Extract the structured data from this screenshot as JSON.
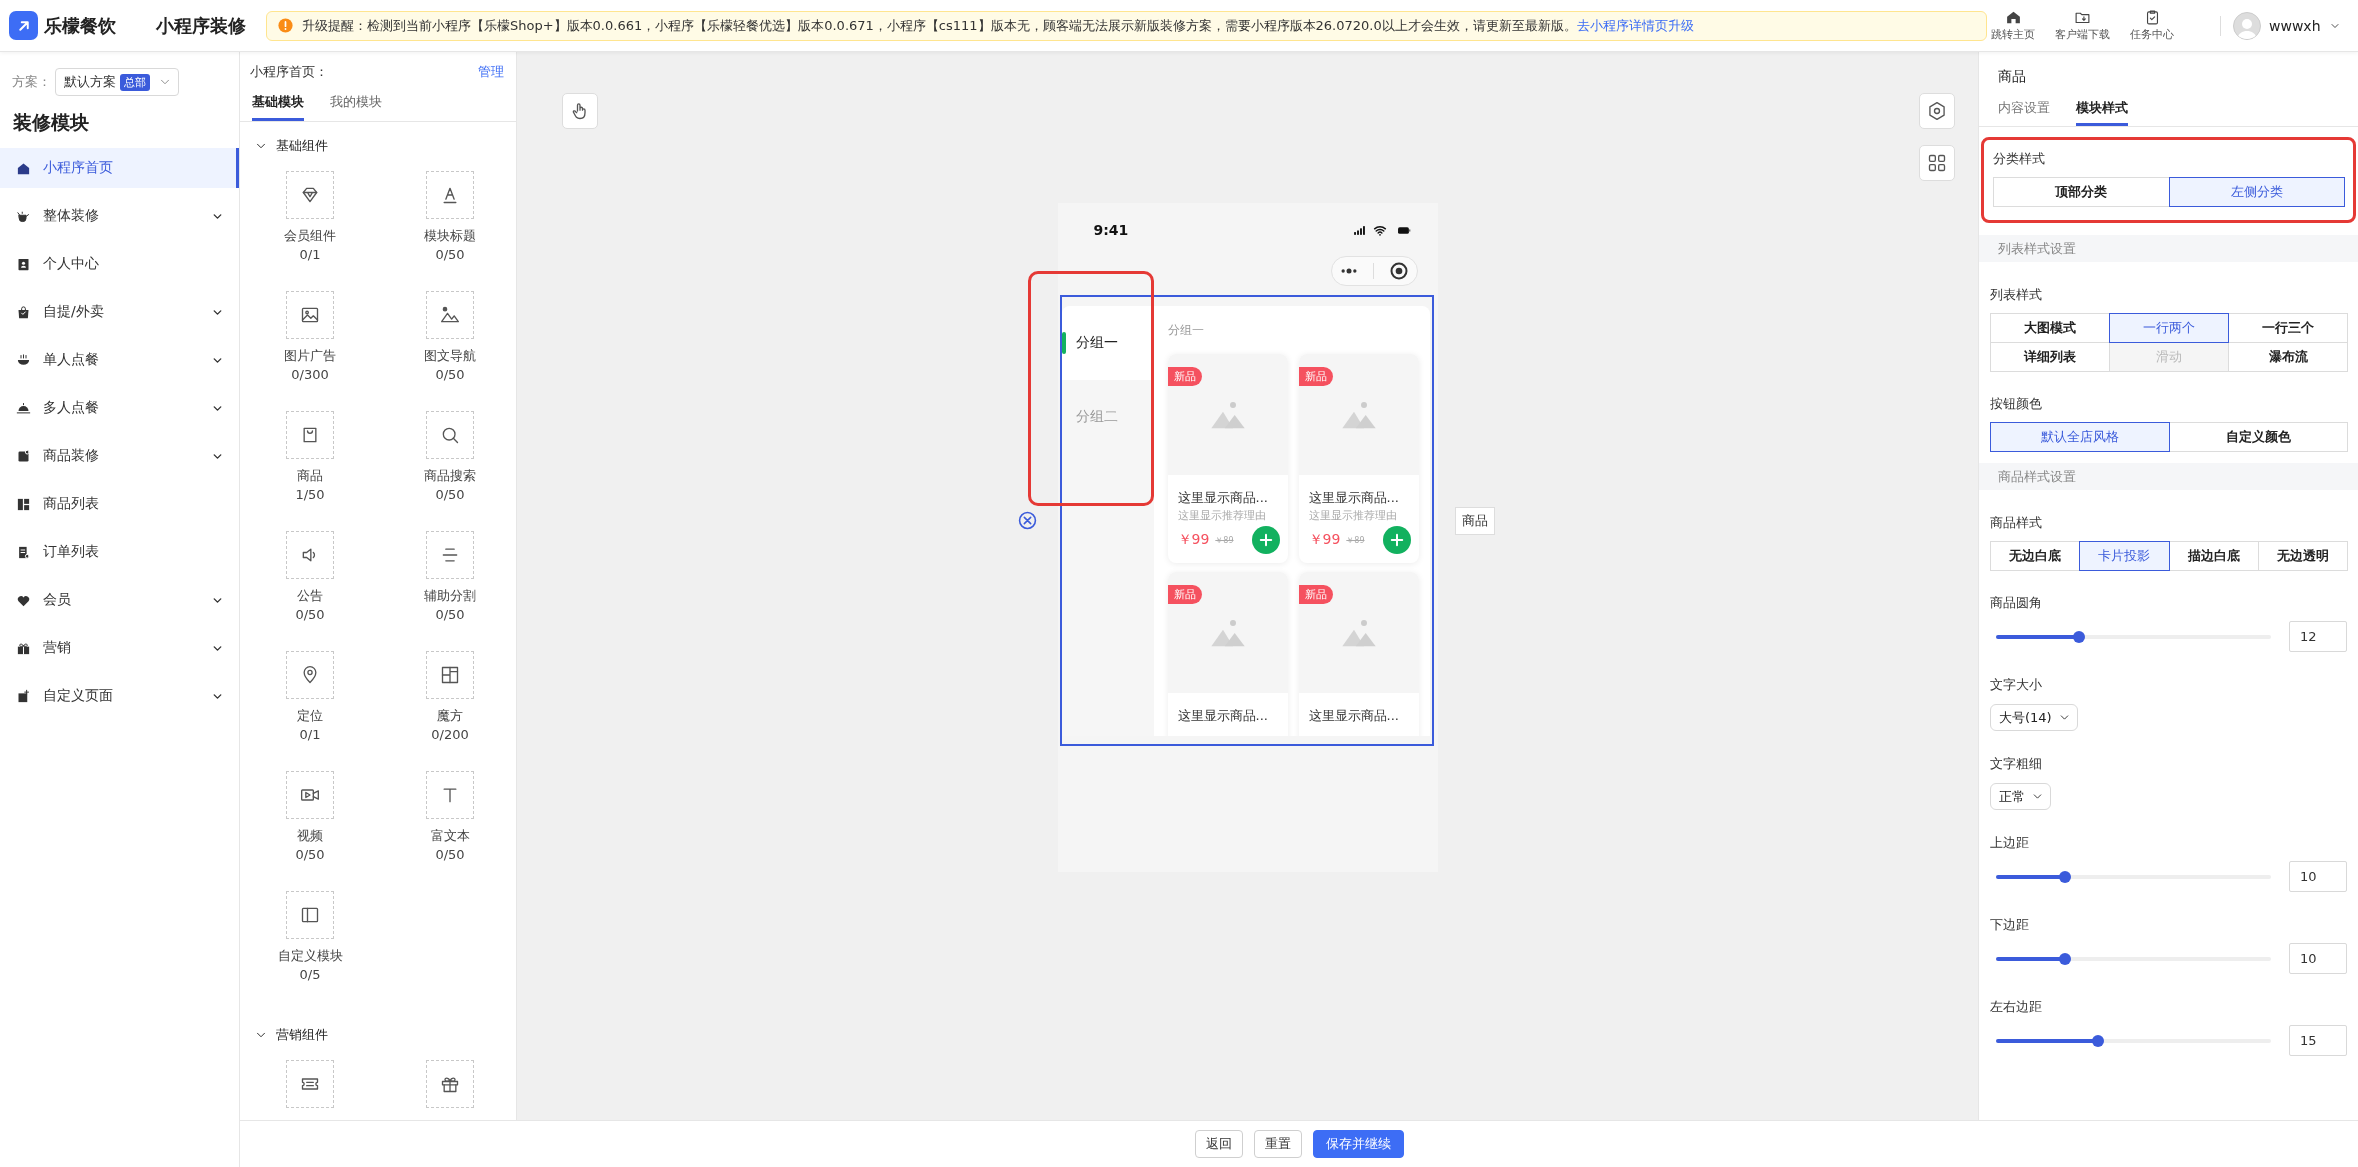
{
  "header": {
    "brand": "乐檬餐饮",
    "page_title": "小程序装修",
    "notice": {
      "text": "升级提醒：检测到当前小程序【乐檬Shop+】版本0.0.661，小程序【乐檬轻餐优选】版本0.0.671，小程序【cs111】版本无，顾客端无法展示新版装修方案，需要小程序版本26.0720.0以上才会生效，请更新至最新版。",
      "link": "去小程序详情页升级"
    },
    "actions": [
      {
        "label": "跳转主页"
      },
      {
        "label": "客户端下载"
      },
      {
        "label": "任务中心"
      }
    ],
    "user": {
      "name": "wwwxh"
    }
  },
  "sidebar": {
    "scheme_label": "方案：",
    "scheme": "默认方案",
    "scheme_badge": "总部",
    "title": "装修模块",
    "items": [
      {
        "label": "小程序首页",
        "selected": true,
        "expandable": false
      },
      {
        "label": "整体装修",
        "selected": false,
        "expandable": true
      },
      {
        "label": "个人中心",
        "selected": false,
        "expandable": false
      },
      {
        "label": "自提/外卖",
        "selected": false,
        "expandable": true
      },
      {
        "label": "单人点餐",
        "selected": false,
        "expandable": true
      },
      {
        "label": "多人点餐",
        "selected": false,
        "expandable": true
      },
      {
        "label": "商品装修",
        "selected": false,
        "expandable": true
      },
      {
        "label": "商品列表",
        "selected": false,
        "expandable": false
      },
      {
        "label": "订单列表",
        "selected": false,
        "expandable": false
      },
      {
        "label": "会员",
        "selected": false,
        "expandable": true
      },
      {
        "label": "营销",
        "selected": false,
        "expandable": true
      },
      {
        "label": "自定义页面",
        "selected": false,
        "expandable": true
      }
    ]
  },
  "module_panel": {
    "title": "小程序首页：",
    "manage": "管理",
    "tabs": [
      {
        "label": "基础模块",
        "selected": true
      },
      {
        "label": "我的模块",
        "selected": false
      }
    ],
    "groups": [
      {
        "title": "基础组件",
        "expanded": true,
        "items": [
          {
            "kind": "full",
            "label": "会员组件",
            "count": "0/1"
          },
          {
            "kind": "full",
            "label": "模块标题",
            "count": "0/50"
          },
          {
            "kind": "full",
            "label": "图片广告",
            "count": "0/300"
          },
          {
            "kind": "full",
            "label": "图文导航",
            "count": "0/50"
          },
          {
            "kind": "full",
            "label": "商品",
            "count": "1/50"
          },
          {
            "kind": "full",
            "label": "商品搜索",
            "count": "0/50"
          },
          {
            "kind": "full",
            "label": "公告",
            "count": "0/50"
          },
          {
            "kind": "full",
            "label": "辅助分割",
            "count": "0/50"
          },
          {
            "kind": "full",
            "label": "定位",
            "count": "0/1"
          },
          {
            "kind": "full",
            "label": "魔方",
            "count": "0/200"
          },
          {
            "kind": "full",
            "label": "视频",
            "count": "0/50"
          },
          {
            "kind": "full",
            "label": "富文本",
            "count": "0/50"
          },
          {
            "kind": "full",
            "label": "自定义模块",
            "count": "0/5"
          }
        ]
      },
      {
        "title": "营销组件",
        "expanded": true,
        "items": [
          {
            "kind": "cut"
          },
          {
            "kind": "cut"
          }
        ]
      }
    ]
  },
  "canvas": {
    "component_tag": "商品",
    "phone": {
      "time": "9:41",
      "highlight_categories": true,
      "categories": [
        {
          "label": "分组一",
          "selected": true
        },
        {
          "label": "分组二",
          "selected": false
        }
      ],
      "group_title": "分组一",
      "products": [
        {
          "badge": "新品",
          "name": "这里显示商品...",
          "reason": "这里显示推荐理由",
          "price": "￥99",
          "original_price": "￥89"
        },
        {
          "badge": "新品",
          "name": "这里显示商品...",
          "reason": "这里显示推荐理由",
          "price": "￥99",
          "original_price": "￥89"
        },
        {
          "badge": "新品",
          "name": "这里显示商品..."
        },
        {
          "badge": "新品",
          "name": "这里显示商品..."
        }
      ]
    }
  },
  "style_panel": {
    "title": "商品",
    "tabs": [
      {
        "label": "内容设置",
        "selected": false
      },
      {
        "label": "模块样式",
        "selected": true
      }
    ],
    "sections": [
      {
        "kind": "segmented",
        "label": "分类样式",
        "highlighted": true,
        "options": [
          {
            "label": "顶部分类",
            "selected": false
          },
          {
            "label": "左侧分类",
            "selected": true
          }
        ]
      },
      {
        "kind": "heading",
        "label": "列表样式设置"
      },
      {
        "kind": "segmented",
        "label": "列表样式",
        "options": [
          {
            "label": "大图模式",
            "selected": false,
            "disabled": false
          },
          {
            "label": "一行两个",
            "selected": true,
            "disabled": false
          },
          {
            "label": "一行三个",
            "selected": false,
            "disabled": false
          },
          {
            "label": "详细列表",
            "selected": false,
            "disabled": false
          },
          {
            "label": "滑动",
            "selected": false,
            "disabled": true
          },
          {
            "label": "瀑布流",
            "selected": false,
            "disabled": false
          }
        ]
      },
      {
        "kind": "segmented",
        "label": "按钮颜色",
        "options": [
          {
            "label": "默认全店风格",
            "selected": true
          },
          {
            "label": "自定义颜色",
            "selected": false
          }
        ]
      },
      {
        "kind": "heading",
        "label": "商品样式设置"
      },
      {
        "kind": "segmented",
        "label": "商品样式",
        "options": [
          {
            "label": "无边白底",
            "selected": false
          },
          {
            "label": "卡片投影",
            "selected": true
          },
          {
            "label": "描边白底",
            "selected": false
          },
          {
            "label": "无边透明",
            "selected": false
          }
        ]
      },
      {
        "kind": "slider",
        "label": "商品圆角",
        "level": 0.3,
        "value": "12"
      },
      {
        "kind": "select",
        "label": "文字大小",
        "value": "大号(14)"
      },
      {
        "kind": "select",
        "label": "文字粗细",
        "value": "正常"
      },
      {
        "kind": "slider",
        "label": "上边距",
        "level": 0.25,
        "value": "10"
      },
      {
        "kind": "slider",
        "label": "下边距",
        "level": 0.25,
        "value": "10"
      },
      {
        "kind": "slider",
        "label": "左右边距",
        "level": 0.37,
        "value": "15"
      }
    ]
  },
  "footer": {
    "buttons": [
      {
        "label": "返回",
        "kind": "default"
      },
      {
        "label": "重置",
        "kind": "default"
      },
      {
        "label": "保存并继续",
        "kind": "primary"
      }
    ]
  }
}
